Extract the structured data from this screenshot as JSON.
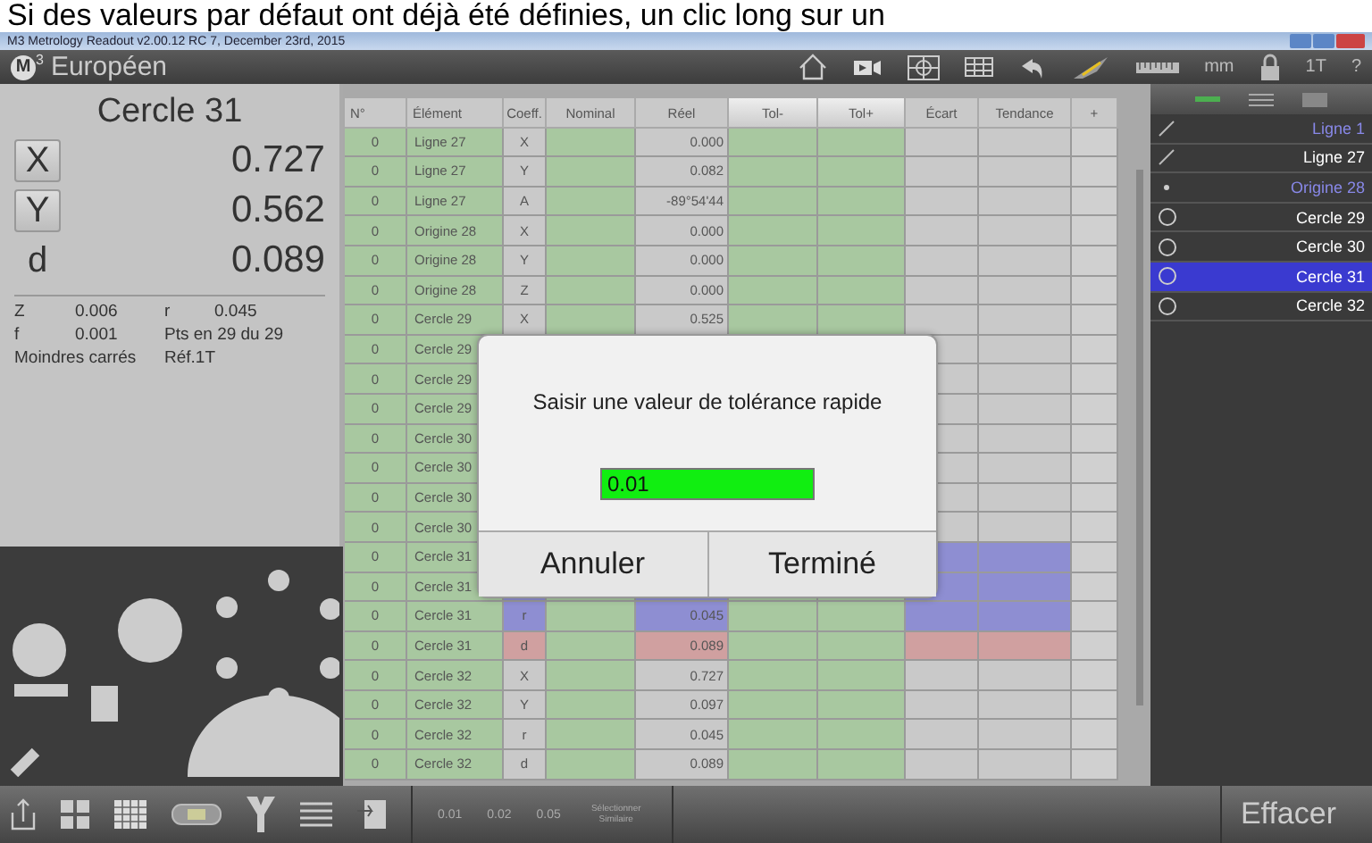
{
  "caption": "Si des valeurs par défaut ont déjà été définies, un clic long sur un",
  "window": {
    "title": "M3 Metrology Readout  v2.00.12 RC 7, December 23rd, 2015"
  },
  "header": {
    "logo": "M",
    "logo_sup": "3",
    "language": "Européen",
    "unit": "mm",
    "ref": "1T",
    "help": "?"
  },
  "readout": {
    "feature": "Cercle 31",
    "axes": [
      {
        "label": "X",
        "kind": "button",
        "value": "0.727"
      },
      {
        "label": "Y",
        "kind": "button",
        "value": "0.562"
      },
      {
        "label": "d",
        "kind": "plain",
        "value": "0.089"
      }
    ],
    "details": [
      {
        "kind": "pair",
        "label": "Z",
        "value": "0.006"
      },
      {
        "kind": "pair",
        "label": "r",
        "value": "0.045"
      },
      {
        "kind": "pair",
        "label": "f",
        "value": "0.001"
      },
      {
        "kind": "text",
        "text": "Pts en 29 du 29"
      },
      {
        "kind": "text",
        "text": "Moindres carrés"
      },
      {
        "kind": "text",
        "text": "Réf.1T"
      }
    ]
  },
  "table": {
    "columns": [
      "N°",
      "Élément",
      "Coeff.",
      "Nominal",
      "Réel",
      "Tol-",
      "Tol+",
      "Écart",
      "Tendance",
      "+"
    ],
    "rows": [
      {
        "n": "0",
        "element": "Ligne 27",
        "coeff": "X",
        "reel": "0.000"
      },
      {
        "n": "0",
        "element": "Ligne 27",
        "coeff": "Y",
        "reel": "0.082"
      },
      {
        "n": "0",
        "element": "Ligne 27",
        "coeff": "A",
        "reel": "-89°54'44"
      },
      {
        "n": "0",
        "element": "Origine 28",
        "coeff": "X",
        "reel": "0.000"
      },
      {
        "n": "0",
        "element": "Origine 28",
        "coeff": "Y",
        "reel": "0.000"
      },
      {
        "n": "0",
        "element": "Origine 28",
        "coeff": "Z",
        "reel": "0.000"
      },
      {
        "n": "0",
        "element": "Cercle 29",
        "coeff": "X",
        "reel": "0.525"
      },
      {
        "n": "0",
        "element": "Cercle 29"
      },
      {
        "n": "0",
        "element": "Cercle 29"
      },
      {
        "n": "0",
        "element": "Cercle 29"
      },
      {
        "n": "0",
        "element": "Cercle 30"
      },
      {
        "n": "0",
        "element": "Cercle 30"
      },
      {
        "n": "0",
        "element": "Cercle 30"
      },
      {
        "n": "0",
        "element": "Cercle 30"
      },
      {
        "n": "0",
        "element": "Cercle 31",
        "color": "#8e8ed2"
      },
      {
        "n": "0",
        "element": "Cercle 31",
        "color": "#8e8ed2"
      },
      {
        "n": "0",
        "element": "Cercle 31",
        "coeff": "r",
        "reel": "0.045",
        "color": "#8e8ed2"
      },
      {
        "n": "0",
        "element": "Cercle 31",
        "coeff": "d",
        "reel": "0.089",
        "color": "#d0a0a0"
      },
      {
        "n": "0",
        "element": "Cercle 32",
        "coeff": "X",
        "reel": "0.727"
      },
      {
        "n": "0",
        "element": "Cercle 32",
        "coeff": "Y",
        "reel": "0.097"
      },
      {
        "n": "0",
        "element": "Cercle 32",
        "coeff": "r",
        "reel": "0.045"
      },
      {
        "n": "0",
        "element": "Cercle 32",
        "coeff": "d",
        "reel": "0.089"
      }
    ]
  },
  "dialog": {
    "prompt": "Saisir une valeur de tolérance rapide",
    "value": "0.01",
    "buttons": [
      "Annuler",
      "Terminé"
    ]
  },
  "features": [
    {
      "kind": "line",
      "label": "Ligne 1",
      "color": "#8888e8",
      "selected": false
    },
    {
      "kind": "line",
      "label": "Ligne 27",
      "color": "#ffffff",
      "selected": false
    },
    {
      "kind": "point",
      "label": "Origine 28",
      "color": "#8888e8",
      "selected": false
    },
    {
      "kind": "circle",
      "label": "Cercle 29",
      "color": "#ffffff",
      "selected": false
    },
    {
      "kind": "circle",
      "label": "Cercle 30",
      "color": "#ffffff",
      "selected": false
    },
    {
      "kind": "circle",
      "label": "Cercle 31",
      "color": "#ffffff",
      "selected": true
    },
    {
      "kind": "circle",
      "label": "Cercle 32",
      "color": "#ffffff",
      "selected": false
    }
  ],
  "bottom_bar": {
    "tolerances": [
      "0.01",
      "0.02",
      "0.05"
    ],
    "select_similar": "Sélectionner Similaire",
    "clear": "Effacer"
  }
}
